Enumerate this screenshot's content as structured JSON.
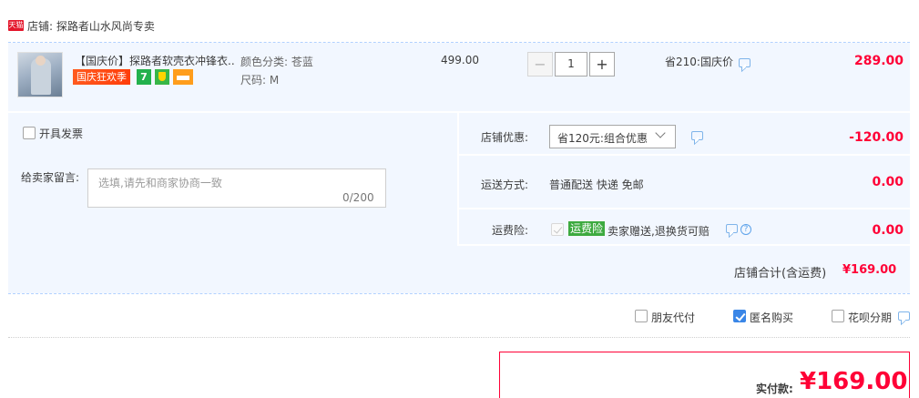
{
  "shop": {
    "badge": "天猫",
    "name": "店铺: 探路者山水风尚专卖"
  },
  "item": {
    "title": "【国庆价】探路者软壳衣冲锋衣...",
    "tags": {
      "festival": "国庆狂欢季",
      "seven_day": "7"
    },
    "sku_color": "颜色分类: 苍蓝",
    "sku_size": "尺码: M",
    "unit_price": "499.00",
    "quantity": "1",
    "qty_minus": "−",
    "qty_plus": "+",
    "discount_note": "省210:国庆价",
    "total": "289.00"
  },
  "options": {
    "invoice_label": "开具发票",
    "memo_label": "给卖家留言:",
    "memo_placeholder": "选填,请先和商家协商一致",
    "memo_count": "0/200",
    "shop_discount_label": "店铺优惠:",
    "shop_discount_value": "省120元:组合优惠",
    "shop_discount_amount": "-120.00",
    "shipping_label": "运送方式:",
    "shipping_value": "普通配送 快递 免邮",
    "shipping_amount": "0.00",
    "insurance_label": "运费险:",
    "insurance_badge": "运费险",
    "insurance_text": "卖家赠送,退换货可赔",
    "insurance_amount": "0.00",
    "subtotal_label": "店铺合计(含运费)",
    "subtotal_value": "¥169.00"
  },
  "payment_options": {
    "friend_pay": "朋友代付",
    "anonymous": "匿名购买",
    "anonymous_checked": true,
    "huabei": "花呗分期"
  },
  "pay": {
    "label": "实付款:",
    "amount": "¥169.00"
  },
  "colors": {
    "accent_red": "#ff0036",
    "panel_blue": "#f2f7ff",
    "tmall_red": "#e4162b"
  }
}
